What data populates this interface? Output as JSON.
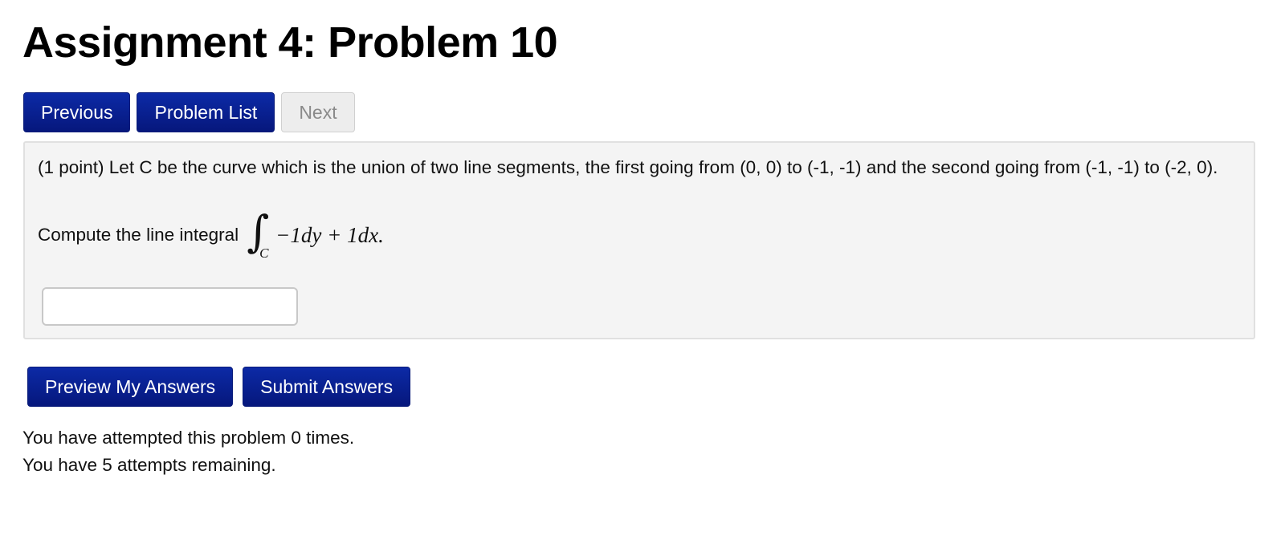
{
  "page": {
    "title": "Assignment 4: Problem 10"
  },
  "nav": {
    "previous_label": "Previous",
    "problem_list_label": "Problem List",
    "next_label": "Next"
  },
  "problem": {
    "statement": "(1 point) Let C be the curve which is the union of two line segments, the first going from (0, 0) to (-1, -1) and the second going from (-1, -1) to (-2, 0).",
    "compute_prefix": "Compute the line integral",
    "integral_symbol": "∫",
    "integral_subscript": "C",
    "integrand": "−1dy + 1dx.",
    "answer_value": "",
    "answer_placeholder": ""
  },
  "actions": {
    "preview_label": "Preview My Answers",
    "submit_label": "Submit Answers"
  },
  "status": {
    "attempts_text": "You have attempted this problem 0 times.",
    "remaining_text": "You have 5 attempts remaining."
  },
  "colors": {
    "button_primary": "#0c2aa6",
    "button_disabled": "#ededed",
    "panel_background": "#f4f4f4"
  }
}
